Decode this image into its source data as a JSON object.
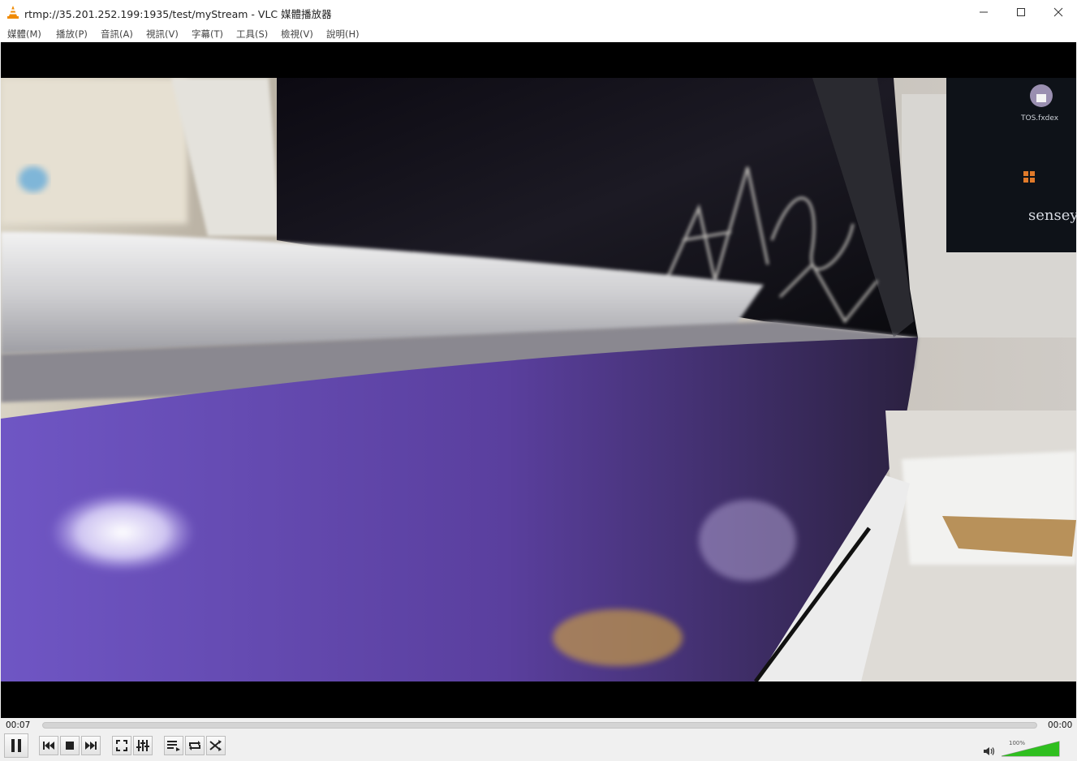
{
  "window": {
    "title": "rtmp://35.201.252.199:1935/test/myStream - VLC 媒體播放器"
  },
  "menu": [
    {
      "label": "媒體(M)"
    },
    {
      "label": "播放(P)"
    },
    {
      "label": "音訊(A)"
    },
    {
      "label": "視訊(V)"
    },
    {
      "label": "字幕(T)"
    },
    {
      "label": "工具(S)"
    },
    {
      "label": "檢視(V)"
    },
    {
      "label": "說明(H)"
    }
  ],
  "player": {
    "elapsed": "00:07",
    "remaining": "00:00",
    "progress": 0,
    "volume_label": "100%",
    "volume": 1.0
  },
  "video_overlay": {
    "monitor_text": "sensey",
    "monitor_icon_text": "TOS.fxdex"
  },
  "icons": [
    "vlc-cone-icon",
    "minimize-icon",
    "maximize-icon",
    "close-icon",
    "pause-icon",
    "previous-icon",
    "stop-icon",
    "next-icon",
    "fullscreen-icon",
    "extended-settings-icon",
    "playlist-icon",
    "loop-icon",
    "shuffle-icon",
    "speaker-icon"
  ],
  "colors": {
    "accent_volume": "#2fbf1f",
    "video_purple": "#5b45a6"
  }
}
